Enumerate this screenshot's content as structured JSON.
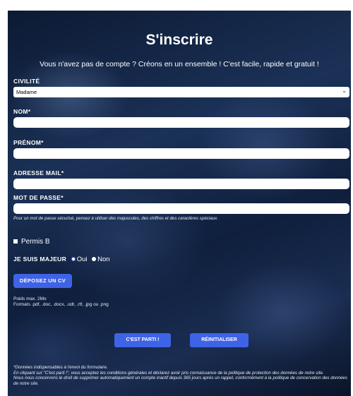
{
  "form": {
    "title": "S'inscrire",
    "intro": "Vous n'avez pas de compte ? Créons en un ensemble ! C'est facile, rapide et gratuit !",
    "civilite_label": "CIVILITÉ",
    "civilite_value": "Madame",
    "nom_label": "NOM*",
    "prenom_label": "PRÉNOM*",
    "email_label": "ADRESSE MAIL*",
    "password_label": "MOT DE PASSE*",
    "password_hint": "Pour un mot de passe sécurisé, pensez à utiliser des majuscules, des chiffres et des caractères spéciaux.",
    "permis_label": "Permis B",
    "majeur_label": "JE SUIS MAJEUR",
    "majeur_oui": "Oui",
    "majeur_non": "Non",
    "cv_button": "DÉPOSEZ UN CV",
    "cv_size": "Poids max. 2Mo",
    "cv_formats": "Formats .pdf, .doc, .docx, .odt, .rtf, .jpg ou .png",
    "submit_button": "C'EST PARTI !",
    "reset_button": "RÉINITIALISER",
    "footer_1": "*Données indispensables à l'envoi du formulaire.",
    "footer_2": "En cliquant sur \"C'est parti !\", vous acceptez les conditions générales et déclarez avoir pris connaissance de la politique de protection des données de notre site.",
    "footer_3": "Nous nous concervons le droit de supprimer automatiquement un compte inactif depuis 365 jours après un rappel, conformément à la politique de concervation des données de notre site."
  },
  "colors": {
    "accent": "#3f63e6",
    "text": "#ffffff"
  },
  "icons": {
    "select_arrow": "chevron-down-icon"
  }
}
